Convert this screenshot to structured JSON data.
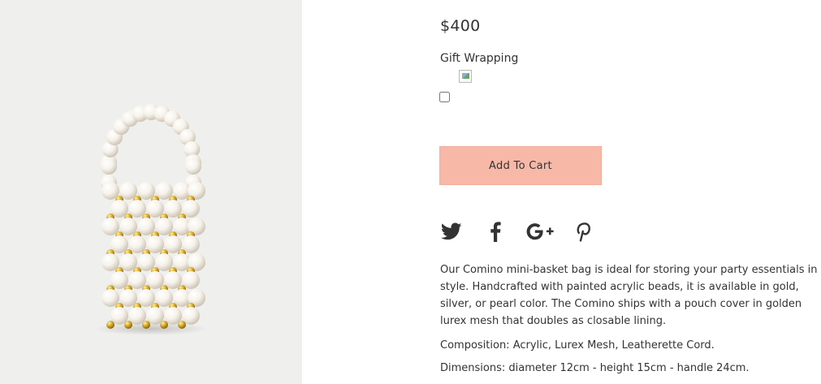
{
  "product": {
    "image_alt": "Pearl beaded mini-basket bag",
    "price": "$400",
    "gift_wrapping_label": "Gift Wrapping",
    "gift_wrapping_checked": false,
    "add_to_cart_label": "Add To Cart"
  },
  "share": {
    "icons": [
      "twitter-icon",
      "facebook-icon",
      "google-plus-icon",
      "pinterest-icon"
    ],
    "icon_color": "#333333"
  },
  "description": {
    "lines": [
      "Our Comino mini-basket bag is ideal for storing your party essentials in",
      "style. Handcrafted with painted acrylic beads, it is available in gold,",
      "silver, or pearl color. The Comino ships with a pouch cover in golden",
      "lurex mesh that doubles as closable lining."
    ],
    "composition": "Composition: Acrylic, Lurex Mesh, Leatherette Cord.",
    "dimensions": "Dimensions: diameter 12cm - height 15cm - handle 24cm."
  },
  "colors": {
    "accent_button": "#f8b8a8",
    "image_background": "#efefed",
    "pearl": "#f6f2ea",
    "gold": "#d6a92a"
  }
}
